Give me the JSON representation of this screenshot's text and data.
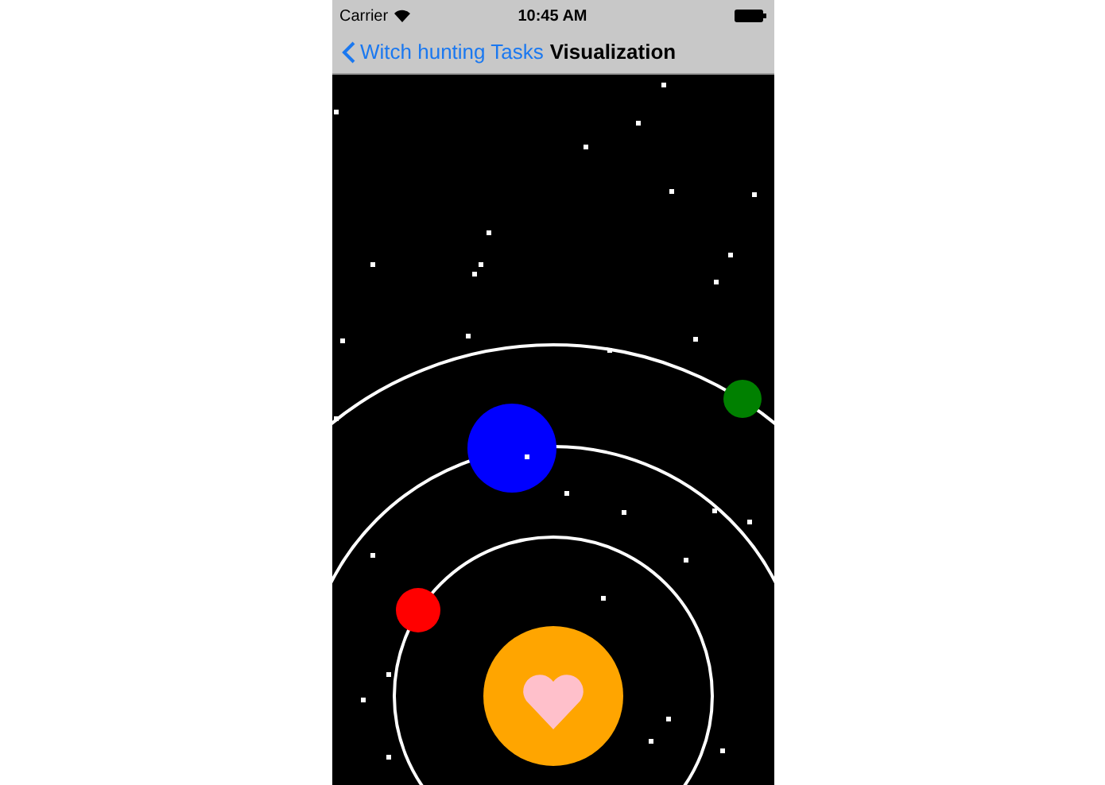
{
  "status_bar": {
    "carrier": "Carrier",
    "time": "10:45 AM"
  },
  "nav_bar": {
    "back_label": "Witch hunting Tasks",
    "title": "Visualization"
  },
  "planets": [
    {
      "color": "#0000ff"
    },
    {
      "color": "#008000"
    },
    {
      "color": "#ff0000"
    }
  ]
}
